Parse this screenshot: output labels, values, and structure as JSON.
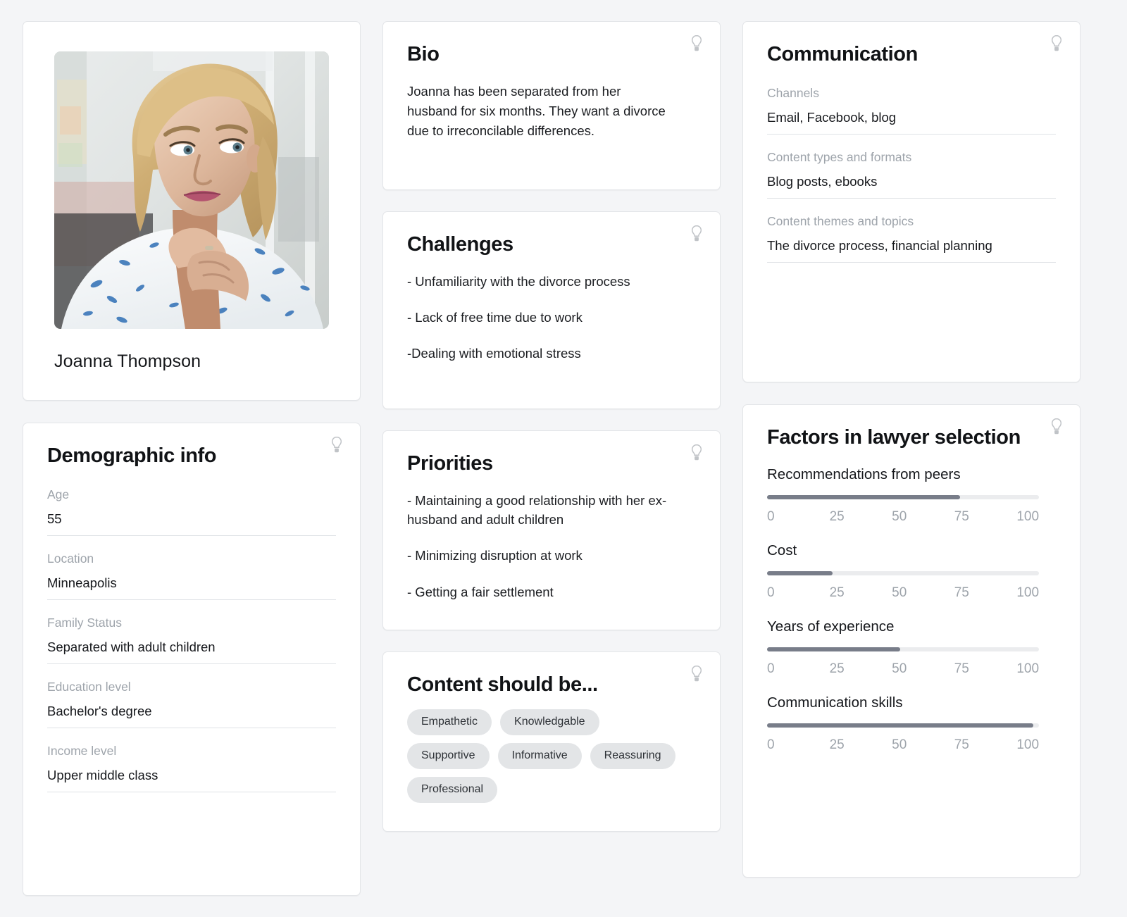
{
  "profile": {
    "name": "Joanna Thompson",
    "photo_alt": "portrait-photo"
  },
  "demographic": {
    "title": "Demographic info",
    "fields": [
      {
        "label": "Age",
        "value": "55"
      },
      {
        "label": "Location",
        "value": "Minneapolis"
      },
      {
        "label": "Family Status",
        "value": "Separated with adult children"
      },
      {
        "label": "Education level",
        "value": "Bachelor's degree"
      },
      {
        "label": "Income level",
        "value": "Upper middle class"
      }
    ]
  },
  "bio": {
    "title": "Bio",
    "text": "Joanna has been separated from her husband for six months. They want a divorce due to irreconcilable differences."
  },
  "challenges": {
    "title": "Challenges",
    "items": [
      "- Unfamiliarity with the divorce process",
      "- Lack of free time due to work",
      "-Dealing with emotional stress"
    ]
  },
  "priorities": {
    "title": "Priorities",
    "items": [
      "- Maintaining a good relationship with her ex-husband and adult children",
      "- Minimizing disruption at work",
      "- Getting a fair settlement"
    ]
  },
  "content_should_be": {
    "title": "Content should be...",
    "tags": [
      "Empathetic",
      "Knowledgable",
      "Supportive",
      "Informative",
      "Reassuring",
      "Professional"
    ]
  },
  "communication": {
    "title": "Communication",
    "fields": [
      {
        "label": "Channels",
        "value": "Email, Facebook, blog"
      },
      {
        "label": "Content types and formats",
        "value": "Blog posts, ebooks"
      },
      {
        "label": "Content themes and topics",
        "value": "The divorce process, financial planning"
      }
    ]
  },
  "chart_data": {
    "type": "bar",
    "title": "Factors in lawyer selection",
    "orientation": "horizontal",
    "categories": [
      "Recommendations from peers",
      "Cost",
      "Years of experience",
      "Communication skills"
    ],
    "values": [
      71,
      24,
      49,
      98
    ],
    "xlim": [
      0,
      100
    ],
    "tick_labels": [
      "0",
      "25",
      "50",
      "75",
      "100"
    ],
    "grid": false,
    "legend": "none",
    "xlabel": "",
    "ylabel": "",
    "fill_color": "#787d89",
    "track_color": "#ebecee"
  },
  "icons": {
    "bulb": "lightbulb-icon"
  }
}
